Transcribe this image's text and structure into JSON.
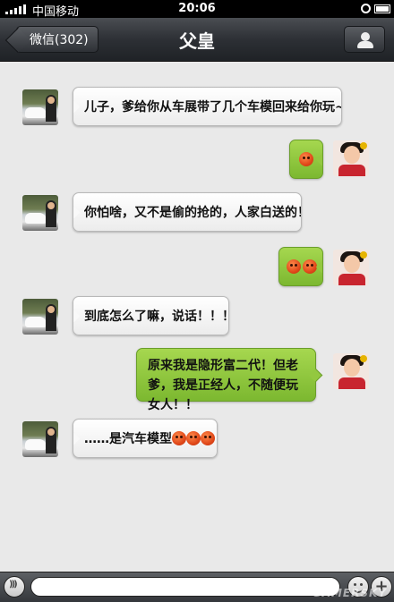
{
  "status_bar": {
    "carrier": "中国移动",
    "time": "20:06"
  },
  "nav": {
    "back_label": "微信(302)",
    "title": "父皇"
  },
  "messages": [
    {
      "side": "left",
      "text": "儿子，爹给你从车展带了几个车模回来给你玩~",
      "emoji_count": 0
    },
    {
      "side": "right",
      "text": "",
      "emoji_count": 1
    },
    {
      "side": "left",
      "text": "你怕啥，又不是偷的抢的，人家白送的！",
      "emoji_count": 0
    },
    {
      "side": "right",
      "text": "",
      "emoji_count": 2
    },
    {
      "side": "left",
      "text": "到底怎么了嘛，说话！！！",
      "emoji_count": 0
    },
    {
      "side": "right",
      "text": "原来我是隐形富二代！但老爹，我是正经人，不随便玩女人！！",
      "emoji_count": 0
    },
    {
      "side": "left",
      "text": "……是汽车模型",
      "emoji_count": 3
    }
  ],
  "input_bar": {
    "plus_label": "+",
    "watermark": "GAMERSKY"
  }
}
